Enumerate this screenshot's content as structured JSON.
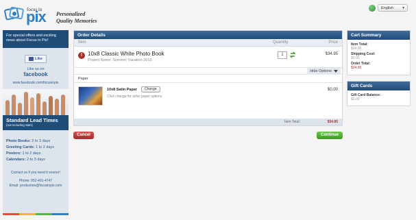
{
  "header": {
    "logo_small": "focus in",
    "logo_pix": "pix",
    "tagline_1": "Personalized",
    "tagline_2": "Quality Memories",
    "language": "English"
  },
  "sidebar": {
    "promo": "For special offers and exciting news about Focus in Pix!",
    "like_label": "Like",
    "like_on": "Like us on",
    "facebook": "facebook",
    "facebook_url": "www.facebook.com/focusinpix",
    "lead_title": "Standard Lead Times",
    "lead_sub": "(not including S&H)",
    "lead_times": [
      {
        "label": "Photo Books:",
        "value": "2 to 3 days"
      },
      {
        "label": "Greeting Cards:",
        "value": "1 to 2 days"
      },
      {
        "label": "Posters:",
        "value": "1 to 2 days"
      },
      {
        "label": "Calendars:",
        "value": "2 to 3 days"
      }
    ],
    "contact_line": "Contact us if you need it sooner!",
    "phone": "Phone: 952-491-4747",
    "email": "Email: production@focusinpix.com"
  },
  "order": {
    "title": "Order Details",
    "col_item": "Item",
    "col_quantity": "Quantity",
    "col_price": "Price",
    "item_title": "10x8 Classic White Photo Book",
    "item_project": "Project Name: Summer Vacation 2013",
    "quantity": "1",
    "item_price": "$34.95",
    "hide_options": "Hide Options",
    "paper_section": "Paper",
    "paper_name": "10x8 Satin Paper",
    "change_label": "Change",
    "paper_hint": "Click change for other paper options",
    "paper_price": "$0.00",
    "item_total_label": "Item Total:",
    "item_total": "$34.95"
  },
  "actions": {
    "cancel": "Cancel",
    "continue": "Continue"
  },
  "cart_summary": {
    "title": "Cart Summary",
    "item_total_label": "Item Total:",
    "item_total": "$34.95",
    "shipping_label": "Shipping Cost:",
    "shipping": "$0.00",
    "order_total_label": "Order Total:",
    "order_total": "$34.95"
  },
  "gift_cards": {
    "title": "Gift Cards",
    "balance_label": "Gift Card Balance:",
    "balance": "$0.00"
  }
}
